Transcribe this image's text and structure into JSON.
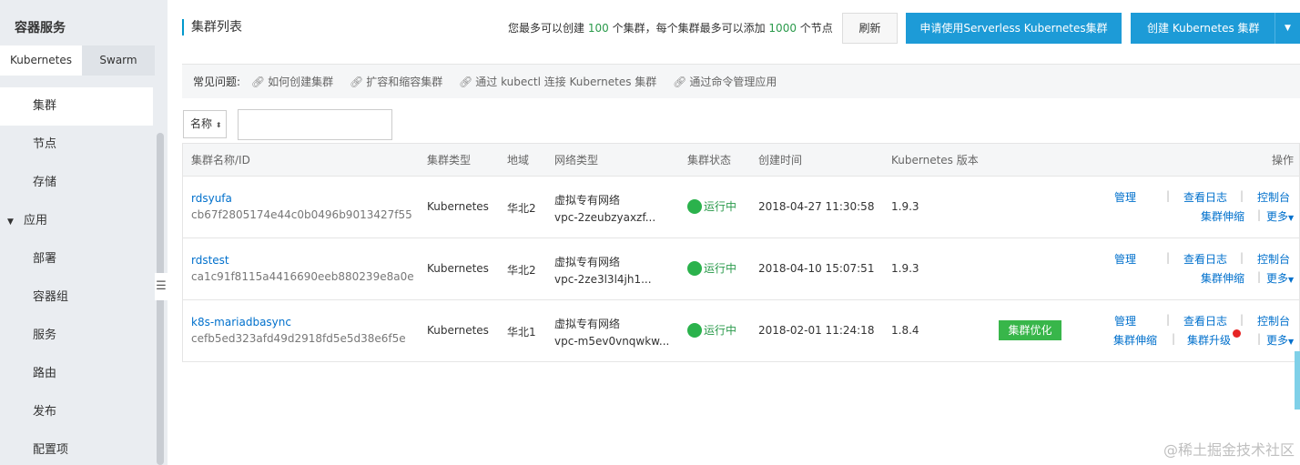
{
  "sidebar": {
    "title": "容器服务",
    "tabs": [
      {
        "label": "Kubernetes"
      },
      {
        "label": "Swarm"
      }
    ],
    "items": [
      {
        "label": "集群"
      },
      {
        "label": "节点"
      },
      {
        "label": "存储"
      },
      {
        "label": "应用"
      },
      {
        "label": "部署"
      },
      {
        "label": "容器组"
      },
      {
        "label": "服务"
      },
      {
        "label": "路由"
      },
      {
        "label": "发布"
      },
      {
        "label": "配置项"
      }
    ],
    "collapse_icon": "menu-collapse-icon",
    "group_caret_icon": "caret-down-icon"
  },
  "header": {
    "title": "集群列表",
    "quota_text_1": "您最多可以创建",
    "quota_num_1": "100",
    "quota_text_2": "个集群，每个集群最多可以添加",
    "quota_num_2": "1000",
    "quota_text_3": "个节点",
    "refresh_label": "刷新",
    "serverless_label": "申请使用Serverless Kubernetes集群",
    "create_label": "创建 Kubernetes 集群",
    "create_caret": "▼"
  },
  "faq": {
    "label": "常见问题:",
    "links": [
      {
        "label": "如何创建集群"
      },
      {
        "label": "扩容和缩容集群"
      },
      {
        "label": "通过 kubectl 连接 Kubernetes 集群"
      },
      {
        "label": "通过命令管理应用"
      }
    ],
    "link_icon": "🔗"
  },
  "filter": {
    "select_value": "名称",
    "input_value": ""
  },
  "table": {
    "headers": {
      "name": "集群名称/ID",
      "type": "集群类型",
      "region": "地域",
      "network": "网络类型",
      "status": "集群状态",
      "created": "创建时间",
      "version": "Kubernetes 版本",
      "ops": "操作"
    },
    "rows": [
      {
        "name": "rdsyufa",
        "id": "cb67f2805174e44c0b0496b9013427f55",
        "type": "Kubernetes",
        "region": "华北2",
        "network": "虚拟专有网络",
        "vpc": "vpc-2zeubzyaxzf...",
        "status": "运行中",
        "created": "2018-04-27 11:30:58",
        "version": "1.9.3",
        "ops": {
          "manage": "管理",
          "logs": "查看日志",
          "console": "控制台",
          "scale": "集群伸缩",
          "more": "更多"
        }
      },
      {
        "name": "rdstest",
        "id": "ca1c91f8115a4416690eeb880239e8a0e",
        "type": "Kubernetes",
        "region": "华北2",
        "network": "虚拟专有网络",
        "vpc": "vpc-2ze3l3l4jh1...",
        "status": "运行中",
        "created": "2018-04-10 15:07:51",
        "version": "1.9.3",
        "ops": {
          "manage": "管理",
          "logs": "查看日志",
          "console": "控制台",
          "scale": "集群伸缩",
          "more": "更多"
        }
      },
      {
        "name": "k8s-mariadbasync",
        "id": "cefb5ed323afd49d2918fd5e5d38e6f5e",
        "type": "Kubernetes",
        "region": "华北1",
        "network": "虚拟专有网络",
        "vpc": "vpc-m5ev0vnqwkw...",
        "status": "运行中",
        "created": "2018-02-01 11:24:18",
        "version": "1.8.4",
        "badge": "集群优化",
        "ops": {
          "manage": "管理",
          "logs": "查看日志",
          "console": "控制台",
          "scale": "集群伸缩",
          "upgrade": "集群升级",
          "more": "更多"
        }
      }
    ]
  },
  "watermark": "@稀土掘金技术社区",
  "colors": {
    "accent": "#1d9bd7",
    "link": "#0070cc",
    "running": "#2bb24c",
    "badge": "#38b64a",
    "notify": "#e62424"
  }
}
